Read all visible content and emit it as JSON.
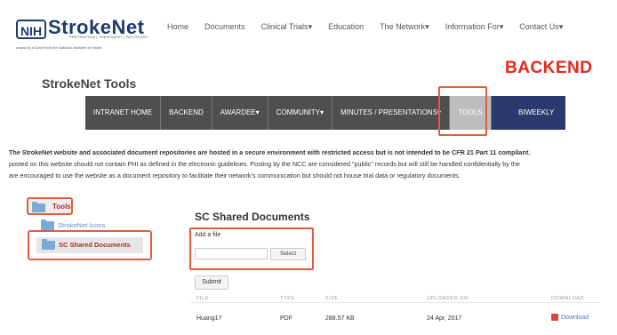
{
  "header": {
    "logo_badge": "NIH",
    "logo_text": "StrokeNet",
    "logo_tagline": "PREVENTION | TREATMENT | RECOVERY",
    "funded_text": "unded by a Grant from the National Institutes of Health",
    "nav": [
      "Home",
      "Documents",
      "Clinical Trials",
      "Education",
      "The Network",
      "Information For",
      "Contact Us"
    ],
    "nav_dropdown_marker": "▾"
  },
  "annotation_label": "BACKEND",
  "page_title": "StrokeNet Tools",
  "navbar": {
    "items": [
      "INTRANET HOME",
      "BACKEND",
      "AWARDEE",
      "COMMUNITY",
      "MINUTES / PRESENTATIONS",
      "TOOLS",
      "BIWEEKLY"
    ],
    "active": "TOOLS"
  },
  "notice": {
    "bold": "The StrokeNet website and associated document repositories are hosted in a secure environment with restricted access but is not intended to be CFR 21 Part 11 compliant.",
    "line2": "posted on this website should not contain PHI as defined in the electronic guidelines. Posting by the NCC are considered \"public\" records but will still be handled confidentially by the",
    "line3": "are encouraged to use the website as a document repository to facilitate their network's communication but should not house trial data or regulatory documents."
  },
  "sidebar": {
    "root": "Tools",
    "items": [
      "StrokeNet Icons",
      "SC Shared Documents"
    ],
    "active": "SC Shared Documents"
  },
  "main": {
    "title": "SC Shared Documents",
    "add_file_label": "Add a file",
    "file_value": "",
    "select_label": "Select",
    "submit_label": "Submit",
    "columns": [
      "FILE",
      "TYPE",
      "SIZE",
      "UPLOADED ON",
      "DOWNLOAD"
    ],
    "rows": [
      {
        "file": "Huang17",
        "type": "PDF",
        "size": "288.57 KB",
        "uploaded": "24 Apr, 2017",
        "download": "Download"
      }
    ]
  },
  "colors": {
    "highlight": "#e45d3a",
    "annotation": "#e8261c",
    "navbar": "#4f4f4f",
    "biweekly": "#2a3a6e",
    "brand": "#1f3a6d"
  }
}
